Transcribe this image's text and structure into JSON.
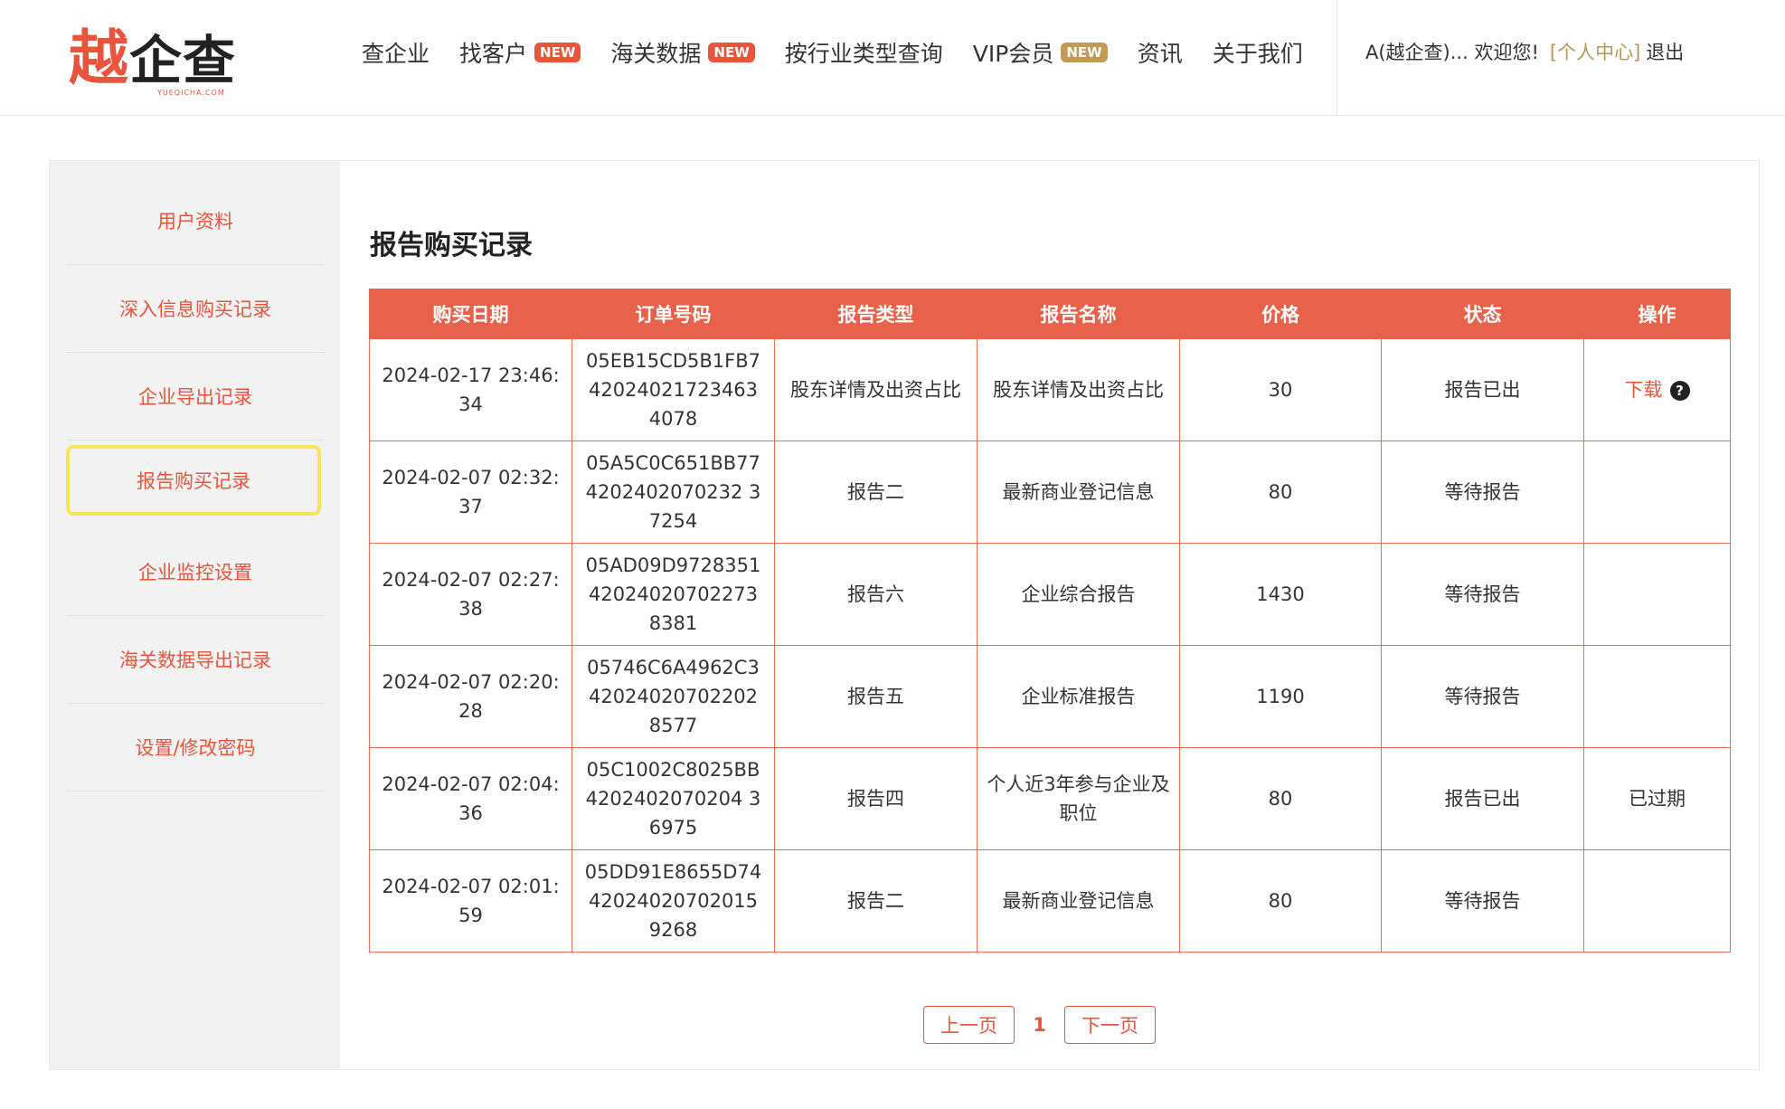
{
  "logo": {
    "char1": "越",
    "rest": "企查",
    "sub": "YUEQICHA.COM"
  },
  "nav": [
    {
      "label": "查企业",
      "style": "red",
      "badge": ""
    },
    {
      "label": "找客户",
      "style": "red",
      "badge": "NEW"
    },
    {
      "label": "海关数据",
      "style": "red",
      "badge": "NEW"
    },
    {
      "label": "按行业类型查询",
      "style": "dark",
      "badge": ""
    },
    {
      "label": "VIP会员",
      "style": "gold",
      "badge": "NEW"
    },
    {
      "label": "资讯",
      "style": "dark",
      "badge": ""
    },
    {
      "label": "关于我们",
      "style": "dark",
      "badge": ""
    }
  ],
  "user": {
    "greeting": "A(越企查)... 欢迎您!",
    "center": "[个人中心]",
    "logout": "退出"
  },
  "sidebar": {
    "items": [
      {
        "label": "用户资料"
      },
      {
        "label": "深入信息购买记录"
      },
      {
        "label": "企业导出记录"
      },
      {
        "label": "报告购买记录",
        "active": true
      },
      {
        "label": "企业监控设置"
      },
      {
        "label": "海关数据导出记录"
      },
      {
        "label": "设置/修改密码"
      }
    ]
  },
  "page_title": "报告购买记录",
  "table": {
    "headers": [
      "购买日期",
      "订单号码",
      "报告类型",
      "报告名称",
      "价格",
      "状态",
      "操作"
    ],
    "rows": [
      {
        "date": "2024-02-17 23:46:34",
        "order": "05EB15CD5B1FB742024021723463 4078",
        "type": "股东详情及出资占比",
        "name": "股东详情及出资占比",
        "price": "30",
        "status": "报告已出",
        "status_kind": "ok",
        "action": "下载",
        "action_kind": "download"
      },
      {
        "date": "2024-02-07 02:32:37",
        "order": "05A5C0C651BB774202402070232 37254",
        "type": "报告二",
        "name": "最新商业登记信息",
        "price": "80",
        "status": "等待报告",
        "status_kind": "wait",
        "action": "",
        "action_kind": "none"
      },
      {
        "date": "2024-02-07 02:27:38",
        "order": "05AD09D972835142024020702273 8381",
        "type": "报告六",
        "name": "企业综合报告",
        "price": "1430",
        "status": "等待报告",
        "status_kind": "wait",
        "action": "",
        "action_kind": "none"
      },
      {
        "date": "2024-02-07 02:20:28",
        "order": "05746C6A4962C342024020702202 8577",
        "type": "报告五",
        "name": "企业标准报告",
        "price": "1190",
        "status": "等待报告",
        "status_kind": "wait",
        "action": "",
        "action_kind": "none"
      },
      {
        "date": "2024-02-07 02:04:36",
        "order": "05C1002C8025BB4202402070204 36975",
        "type": "报告四",
        "name": "个人近3年参与企业及职位",
        "price": "80",
        "status": "报告已出",
        "status_kind": "ok",
        "action": "已过期",
        "action_kind": "text"
      },
      {
        "date": "2024-02-07 02:01:59",
        "order": "05DD91E8655D7442024020702015 9268",
        "type": "报告二",
        "name": "最新商业登记信息",
        "price": "80",
        "status": "等待报告",
        "status_kind": "wait",
        "action": "",
        "action_kind": "none"
      }
    ]
  },
  "pager": {
    "prev": "上一页",
    "current": "1",
    "next": "下一页"
  },
  "colors": {
    "brand_red": "#e8543c",
    "gold": "#b8955a",
    "ok_green": "#27a84d",
    "highlight": "#f8e35a"
  }
}
